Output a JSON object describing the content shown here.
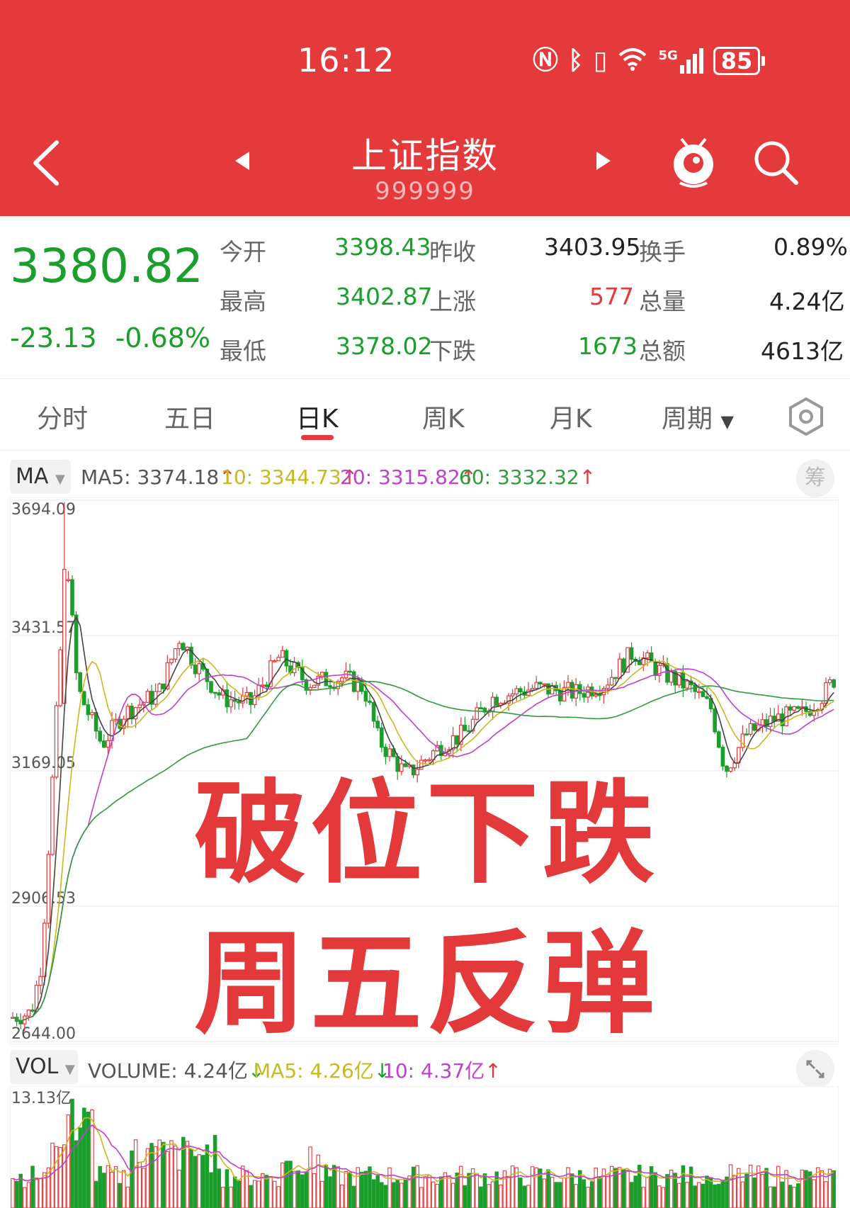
{
  "status": {
    "time": "16:12",
    "battery": "85",
    "signal_tag": "5G"
  },
  "header": {
    "title": "上证指数",
    "code": "999999"
  },
  "quote": {
    "price": "3380.82",
    "change": "-23.13",
    "change_pct": "-0.68%",
    "rows": [
      {
        "l1": "今开",
        "v1": "3398.43",
        "l2": "昨收",
        "v2": "3403.95",
        "l3": "换手",
        "v3": "0.89%"
      },
      {
        "l1": "最高",
        "v1": "3402.87",
        "l2": "上涨",
        "v2": "577",
        "l3": "总量",
        "v3": "4.24亿"
      },
      {
        "l1": "最低",
        "v1": "3378.02",
        "l2": "下跌",
        "v2": "1673",
        "l3": "总额",
        "v3": "4613亿"
      }
    ]
  },
  "tabs": [
    {
      "label": "分时"
    },
    {
      "label": "五日"
    },
    {
      "label": "日K",
      "active": true
    },
    {
      "label": "周K"
    },
    {
      "label": "月K"
    },
    {
      "label": "周期"
    }
  ],
  "ma": {
    "selector": "MA",
    "ma5": "MA5: 3374.18",
    "ma10": "10: 3344.73",
    "ma20": "20: 3315.82",
    "ma60": "60: 3332.32",
    "chou": "筹"
  },
  "vol": {
    "selector": "VOL",
    "volume": "VOLUME: 4.24亿",
    "ma5": "MA5: 4.26亿",
    "ma10": "10: 4.37亿"
  },
  "overlay": {
    "line1": "破位下跌",
    "line2": "周五反弹"
  },
  "colors": {
    "red": "#e43a3c",
    "green": "#1a9e2c",
    "ma10": "#c9b81f",
    "ma20": "#c13fcf",
    "ma60": "#2e9c3c"
  },
  "chart_data": {
    "type": "candlestick",
    "y_ticks": [
      "3694.09",
      "3431.57",
      "3169.05",
      "2906.53",
      "2644.00"
    ],
    "ylim": [
      2644.0,
      3694.09
    ],
    "vol_top_label": "13.13亿",
    "series_names": [
      "MA5",
      "10",
      "20",
      "60"
    ]
  }
}
